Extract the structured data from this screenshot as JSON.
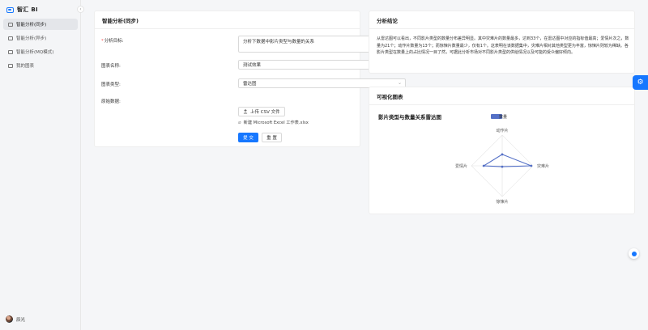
{
  "app": {
    "name": "智汇 BI"
  },
  "sidebar": {
    "items": [
      {
        "label": "智能分析(同步)",
        "icon": "bar-chart-icon",
        "active": true
      },
      {
        "label": "智能分析(异步)",
        "icon": "bar-chart-icon",
        "active": false
      },
      {
        "label": "智能分析(MQ模式)",
        "icon": "chart-box-icon",
        "active": false
      },
      {
        "label": "我的图表",
        "icon": "document-icon",
        "active": false
      }
    ],
    "user": {
      "name": "辰光"
    }
  },
  "form": {
    "title": "智能分析(同步)",
    "goal_label": "分析目标:",
    "goal_value": "分析下数据中影片类型与数量的关系",
    "chart_name_label": "图表名称:",
    "chart_name_value": "测试效果",
    "chart_type_label": "图表类型:",
    "chart_type_value": "雷达图",
    "raw_data_label": "原始数据:",
    "upload_label": "上传 CSV 文件",
    "file_name": "新建 Microsoft Excel 工作表.xlsx",
    "submit_label": "提 交",
    "reset_label": "重 置"
  },
  "conclusion": {
    "title": "分析结论",
    "text": "从雷达图可以看出，不同影片类型的数量分布差异明显。其中灾难片的数量最多，达到33个，在雷达图中对应的指标值最高；爱情片次之，数量为21个；动作片数量为13个；而惊悚片数量最少，仅有1个。这表明在该数据集中，灾难片相对其他类型更为丰富，惊悚片则较为稀缺。各影片类型在数量上的占比情况一目了然，可据此分析市场对不同影片类型的供给情况以及可能的受众偏好倾向。"
  },
  "chart_section": {
    "title": "可视化图表"
  },
  "chart_data": {
    "type": "radar",
    "title": "影片类型与数量关系雷达图",
    "legend": [
      "数量"
    ],
    "legend_position": "top",
    "indicators": [
      "动作片",
      "灾难片",
      "惊悚片",
      "爱情片"
    ],
    "values": [
      13,
      33,
      1,
      21
    ],
    "max": 35,
    "color": "#5470c6"
  },
  "colors": {
    "accent": "#1677ff",
    "required": "#ff4d4f"
  }
}
